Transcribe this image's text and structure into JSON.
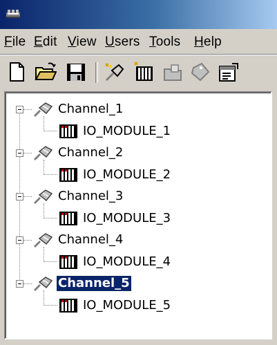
{
  "menu": {
    "file": {
      "label": "File",
      "accel": "F",
      "rest": "ile"
    },
    "edit": {
      "label": "Edit",
      "accel": "E",
      "rest": "dit"
    },
    "view": {
      "label": "View",
      "accel": "V",
      "rest": "iew"
    },
    "users": {
      "label": "Users",
      "accel": "U",
      "rest": "sers"
    },
    "tools": {
      "label": "Tools",
      "accel": "T",
      "rest": "ools"
    },
    "help": {
      "label": "Help",
      "accel": "H",
      "rest": "elp"
    }
  },
  "toolbar": {
    "buttons": [
      "new-icon",
      "open-folder-icon",
      "save-icon",
      "new-channel-icon",
      "new-device-icon",
      "new-group-icon",
      "new-tag-icon",
      "properties-icon"
    ]
  },
  "tree": {
    "channels": [
      {
        "label": "Channel_1",
        "device": "IO_MODULE_1",
        "selected": false
      },
      {
        "label": "Channel_2",
        "device": "IO_MODULE_2",
        "selected": false
      },
      {
        "label": "Channel_3",
        "device": "IO_MODULE_3",
        "selected": false
      },
      {
        "label": "Channel_4",
        "device": "IO_MODULE_4",
        "selected": false
      },
      {
        "label": "Channel_5",
        "device": "IO_MODULE_5",
        "selected": true
      }
    ]
  },
  "colors": {
    "titlebar_start": "#0a246a",
    "titlebar_end": "#a6caf0",
    "selection": "#0a246a",
    "face": "#d4d0c8"
  }
}
